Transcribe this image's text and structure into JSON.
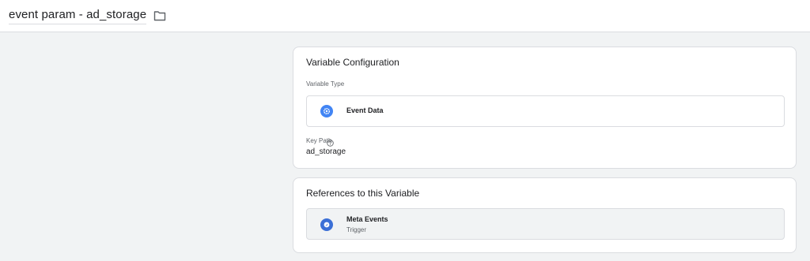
{
  "header": {
    "title": "event param - ad_storage",
    "folder_icon": "folder-icon"
  },
  "config_card": {
    "title": "Variable Configuration",
    "type_label": "Variable Type",
    "type_value": "Event Data",
    "type_icon": "gear-icon",
    "key_path_label": "Key Path",
    "key_path_help_icon": "help-circle-icon",
    "key_path_value": "ad_storage"
  },
  "refs_card": {
    "title": "References to this Variable",
    "items": [
      {
        "name": "Meta Events",
        "type": "Trigger",
        "icon": "trigger-icon"
      }
    ]
  },
  "colors": {
    "background": "#f1f3f4",
    "card": "#ffffff",
    "border": "#dadce0",
    "accent": "#4285f4",
    "trigger_accent": "#3b6fd6",
    "muted_text": "#5f6368"
  }
}
